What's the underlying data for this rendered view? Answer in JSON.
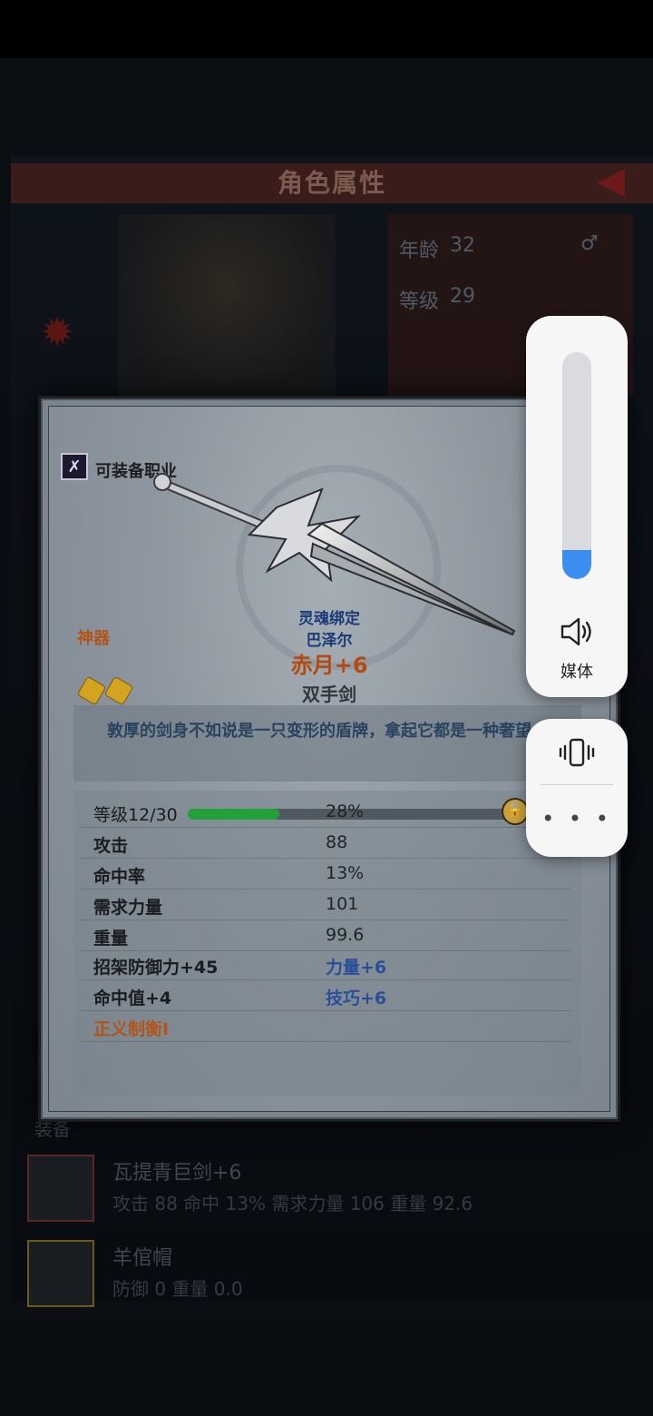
{
  "background": {
    "title": "角色属性",
    "age_label": "年龄",
    "age_value": "32",
    "level_label": "等级",
    "level_value": "29",
    "section_label": "装备",
    "items": [
      {
        "name": "瓦提青巨剑+6",
        "stats": "攻击 88 命中 13% 需求力量 106 重量 92.6"
      },
      {
        "name": "羊倌帽",
        "stats": "防御 0 重量 0.0"
      }
    ]
  },
  "card": {
    "equip_label": "可装备职业",
    "rarity": "神器",
    "soul_bound": "灵魂绑定",
    "owner": "巴泽尔",
    "name": "赤月+6",
    "type": "双手剑",
    "description": "敦厚的剑身不如说是一只变形的盾牌，拿起它都是一种奢望。",
    "level_label": "等级12/30",
    "level_percent_text": "28%",
    "level_progress": 0.28,
    "stats": [
      {
        "label": "攻击",
        "value": "88"
      },
      {
        "label": "命中率",
        "value": "13%"
      },
      {
        "label": "需求力量",
        "value": "101"
      },
      {
        "label": "重量",
        "value": "99.6"
      }
    ],
    "bonuses": [
      {
        "left": "招架防御力+45",
        "right": "力量+6"
      },
      {
        "left": "命中值+4",
        "right": "技巧+6"
      }
    ],
    "special": "正义制衡I"
  },
  "volume": {
    "label": "媒体",
    "level": 0.13,
    "accent": "#3b8ef0"
  },
  "icons": {
    "speaker": "speaker-icon",
    "vibrate": "vibrate-icon",
    "more": "more-icon"
  }
}
